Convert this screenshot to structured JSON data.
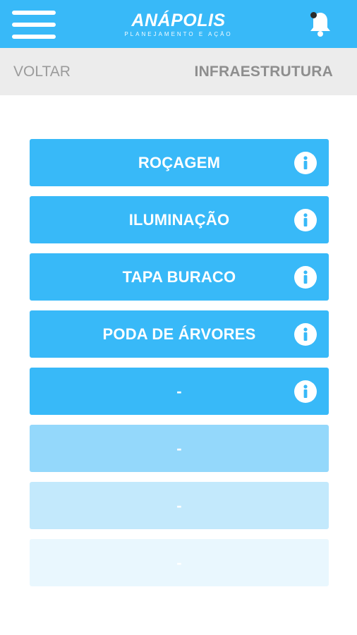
{
  "header": {
    "logo_main": "ANÁPOLIS",
    "logo_sub": "Planejamento e Ação",
    "menu_icon": "hamburger-menu-icon",
    "notification_icon": "bell-icon",
    "brand_color": "#38b9f8"
  },
  "navbar": {
    "back_label": "VOLTAR",
    "title": "INFRAESTRUTURA"
  },
  "items": [
    {
      "label": "ROÇAGEM",
      "icon": "info-icon"
    },
    {
      "label": "ILUMINAÇÃO",
      "icon": "info-icon"
    },
    {
      "label": "TAPA BURACO",
      "icon": "info-icon"
    },
    {
      "label": "PODA DE ÁRVORES",
      "icon": "info-icon"
    },
    {
      "label": "-",
      "icon": "info-icon"
    },
    {
      "label": "-"
    },
    {
      "label": "-"
    },
    {
      "label": "-"
    }
  ]
}
